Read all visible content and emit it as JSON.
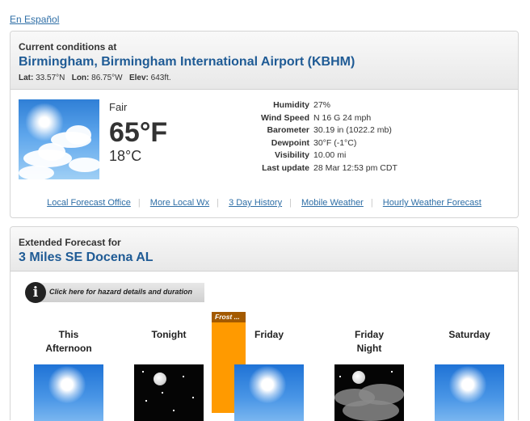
{
  "language_link": "En Español",
  "current": {
    "header_label": "Current conditions at",
    "station": "Birmingham, Birmingham International Airport (KBHM)",
    "lat_label": "Lat:",
    "lat": "33.57°N",
    "lon_label": "Lon:",
    "lon": "86.75°W",
    "elev_label": "Elev:",
    "elev": "643ft.",
    "icon": "sunny-sky-icon",
    "condition": "Fair",
    "temp_f": "65°F",
    "temp_c": "18°C",
    "details": [
      {
        "label": "Humidity",
        "value": "27%"
      },
      {
        "label": "Wind Speed",
        "value": "N 16 G 24 mph"
      },
      {
        "label": "Barometer",
        "value": "30.19 in (1022.2 mb)"
      },
      {
        "label": "Dewpoint",
        "value": "30°F (-1°C)"
      },
      {
        "label": "Visibility",
        "value": "10.00 mi"
      },
      {
        "label": "Last update",
        "value": "28 Mar 12:53 pm CDT"
      }
    ],
    "links": [
      "Local Forecast Office",
      "More Local Wx",
      "3 Day History",
      "Mobile Weather",
      "Hourly Weather Forecast"
    ]
  },
  "extended": {
    "header_label": "Extended Forecast for",
    "location": "3 Miles SE Docena AL",
    "hazard_text": "Click here for hazard details and duration",
    "hazard_icon": "info-icon",
    "frost_label": "Frost ...",
    "frost_color": "#ff9a00",
    "periods": [
      {
        "line1": "This",
        "line2": "Afternoon",
        "icon": "sunny-icon"
      },
      {
        "line1": "Tonight",
        "line2": "",
        "icon": "clear-night-icon"
      },
      {
        "line1": "Friday",
        "line2": "",
        "icon": "sunny-icon"
      },
      {
        "line1": "Friday",
        "line2": "Night",
        "icon": "partly-cloudy-night-icon"
      },
      {
        "line1": "Saturday",
        "line2": "",
        "icon": "sunny-icon"
      }
    ]
  },
  "colors": {
    "link": "#2e6ea6",
    "title": "#1f5b95",
    "frost_bar": "#ff9a00"
  }
}
